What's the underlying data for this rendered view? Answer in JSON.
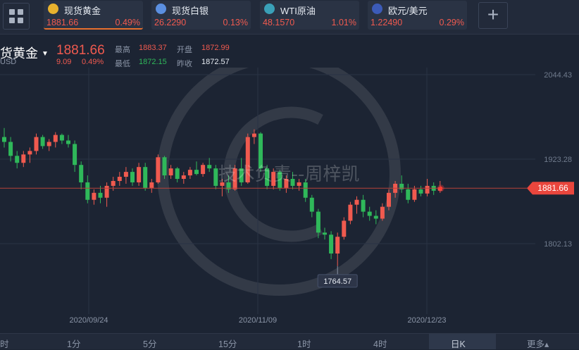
{
  "tickers": [
    {
      "name": "现货黄金",
      "price": "1881.66",
      "change": "0.49%",
      "icon": "gold-coin-icon",
      "icon_color": "#e8b22e",
      "active": true
    },
    {
      "name": "现货白银",
      "price": "26.2290",
      "change": "0.13%",
      "icon": "silver-icon",
      "icon_color": "#5b8fe0",
      "active": false
    },
    {
      "name": "WTI原油",
      "price": "48.1570",
      "change": "1.01%",
      "icon": "oil-barrel-icon",
      "icon_color": "#3aa0b8",
      "active": false
    },
    {
      "name": "欧元/美元",
      "price": "1.22490",
      "change": "0.29%",
      "icon": "eu-us-flag-icon",
      "icon_color": "#3c5bb8",
      "active": false
    }
  ],
  "quote": {
    "symbol": "货黄金",
    "currency": "USD",
    "price": "1881.66",
    "change": "9.09",
    "change_pct": "0.49%",
    "high_label": "最高",
    "high": "1883.37",
    "open_label": "开盘",
    "open": "1872.99",
    "low_label": "最低",
    "low": "1872.15",
    "prev_label": "昨收",
    "prev": "1872.57"
  },
  "watermark": "技术负责--周梓凯",
  "chart_data": {
    "type": "candlestick",
    "y_ticks": [
      "2044.43",
      "1923.28",
      "1802.13"
    ],
    "x_ticks": [
      "2020/09/24",
      "2020/11/09",
      "2020/12/23"
    ],
    "current_price": "1881.66",
    "min_marker": "1764.57",
    "ylim": [
      1730,
      2100
    ],
    "grid": true,
    "colors": {
      "up": "#f05a4f",
      "down": "#2fb85a"
    },
    "candles": [
      [
        1955,
        1968,
        1940,
        1948
      ],
      [
        1948,
        1955,
        1920,
        1928
      ],
      [
        1928,
        1935,
        1910,
        1918
      ],
      [
        1918,
        1935,
        1912,
        1930
      ],
      [
        1930,
        1940,
        1918,
        1935
      ],
      [
        1935,
        1960,
        1930,
        1955
      ],
      [
        1955,
        1958,
        1938,
        1942
      ],
      [
        1942,
        1952,
        1935,
        1948
      ],
      [
        1948,
        1962,
        1940,
        1958
      ],
      [
        1958,
        1960,
        1945,
        1950
      ],
      [
        1950,
        1958,
        1940,
        1945
      ],
      [
        1945,
        1950,
        1905,
        1915
      ],
      [
        1915,
        1920,
        1880,
        1890
      ],
      [
        1890,
        1900,
        1860,
        1865
      ],
      [
        1865,
        1880,
        1858,
        1875
      ],
      [
        1875,
        1885,
        1860,
        1868
      ],
      [
        1868,
        1890,
        1855,
        1885
      ],
      [
        1885,
        1898,
        1878,
        1892
      ],
      [
        1892,
        1905,
        1885,
        1898
      ],
      [
        1898,
        1912,
        1888,
        1905
      ],
      [
        1905,
        1910,
        1885,
        1890
      ],
      [
        1890,
        1918,
        1885,
        1912
      ],
      [
        1912,
        1918,
        1878,
        1882
      ],
      [
        1882,
        1895,
        1875,
        1890
      ],
      [
        1890,
        1930,
        1888,
        1926
      ],
      [
        1926,
        1928,
        1895,
        1900
      ],
      [
        1900,
        1915,
        1895,
        1910
      ],
      [
        1910,
        1912,
        1890,
        1895
      ],
      [
        1895,
        1905,
        1888,
        1900
      ],
      [
        1900,
        1912,
        1895,
        1908
      ],
      [
        1908,
        1920,
        1900,
        1902
      ],
      [
        1902,
        1918,
        1898,
        1915
      ],
      [
        1915,
        1925,
        1905,
        1910
      ],
      [
        1910,
        1915,
        1880,
        1885
      ],
      [
        1885,
        1895,
        1870,
        1890
      ],
      [
        1890,
        1900,
        1875,
        1880
      ],
      [
        1880,
        1915,
        1878,
        1910
      ],
      [
        1910,
        1925,
        1885,
        1890
      ],
      [
        1890,
        1960,
        1888,
        1955
      ],
      [
        1955,
        1966,
        1945,
        1960
      ],
      [
        1960,
        1962,
        1905,
        1910
      ],
      [
        1910,
        1915,
        1880,
        1885
      ],
      [
        1885,
        1910,
        1880,
        1905
      ],
      [
        1905,
        1908,
        1878,
        1882
      ],
      [
        1882,
        1900,
        1875,
        1895
      ],
      [
        1895,
        1905,
        1880,
        1885
      ],
      [
        1885,
        1895,
        1878,
        1890
      ],
      [
        1890,
        1895,
        1862,
        1868
      ],
      [
        1868,
        1872,
        1840,
        1848
      ],
      [
        1848,
        1852,
        1810,
        1818
      ],
      [
        1818,
        1825,
        1808,
        1815
      ],
      [
        1815,
        1820,
        1780,
        1788
      ],
      [
        1788,
        1818,
        1770,
        1812
      ],
      [
        1812,
        1840,
        1808,
        1835
      ],
      [
        1835,
        1862,
        1830,
        1858
      ],
      [
        1858,
        1870,
        1845,
        1865
      ],
      [
        1865,
        1872,
        1840,
        1848
      ],
      [
        1848,
        1855,
        1835,
        1842
      ],
      [
        1842,
        1850,
        1830,
        1838
      ],
      [
        1838,
        1860,
        1835,
        1855
      ],
      [
        1855,
        1880,
        1850,
        1875
      ],
      [
        1875,
        1892,
        1868,
        1888
      ],
      [
        1888,
        1900,
        1875,
        1880
      ],
      [
        1880,
        1888,
        1860,
        1865
      ],
      [
        1865,
        1885,
        1862,
        1880
      ],
      [
        1880,
        1885,
        1870,
        1874
      ],
      [
        1874,
        1895,
        1870,
        1885
      ],
      [
        1885,
        1890,
        1872,
        1878
      ],
      [
        1878,
        1892,
        1875,
        1883
      ]
    ]
  },
  "tabs": [
    "时",
    "1分",
    "5分",
    "15分",
    "1时",
    "4时",
    "日K",
    "更多▴"
  ],
  "selected_tab": "日K"
}
